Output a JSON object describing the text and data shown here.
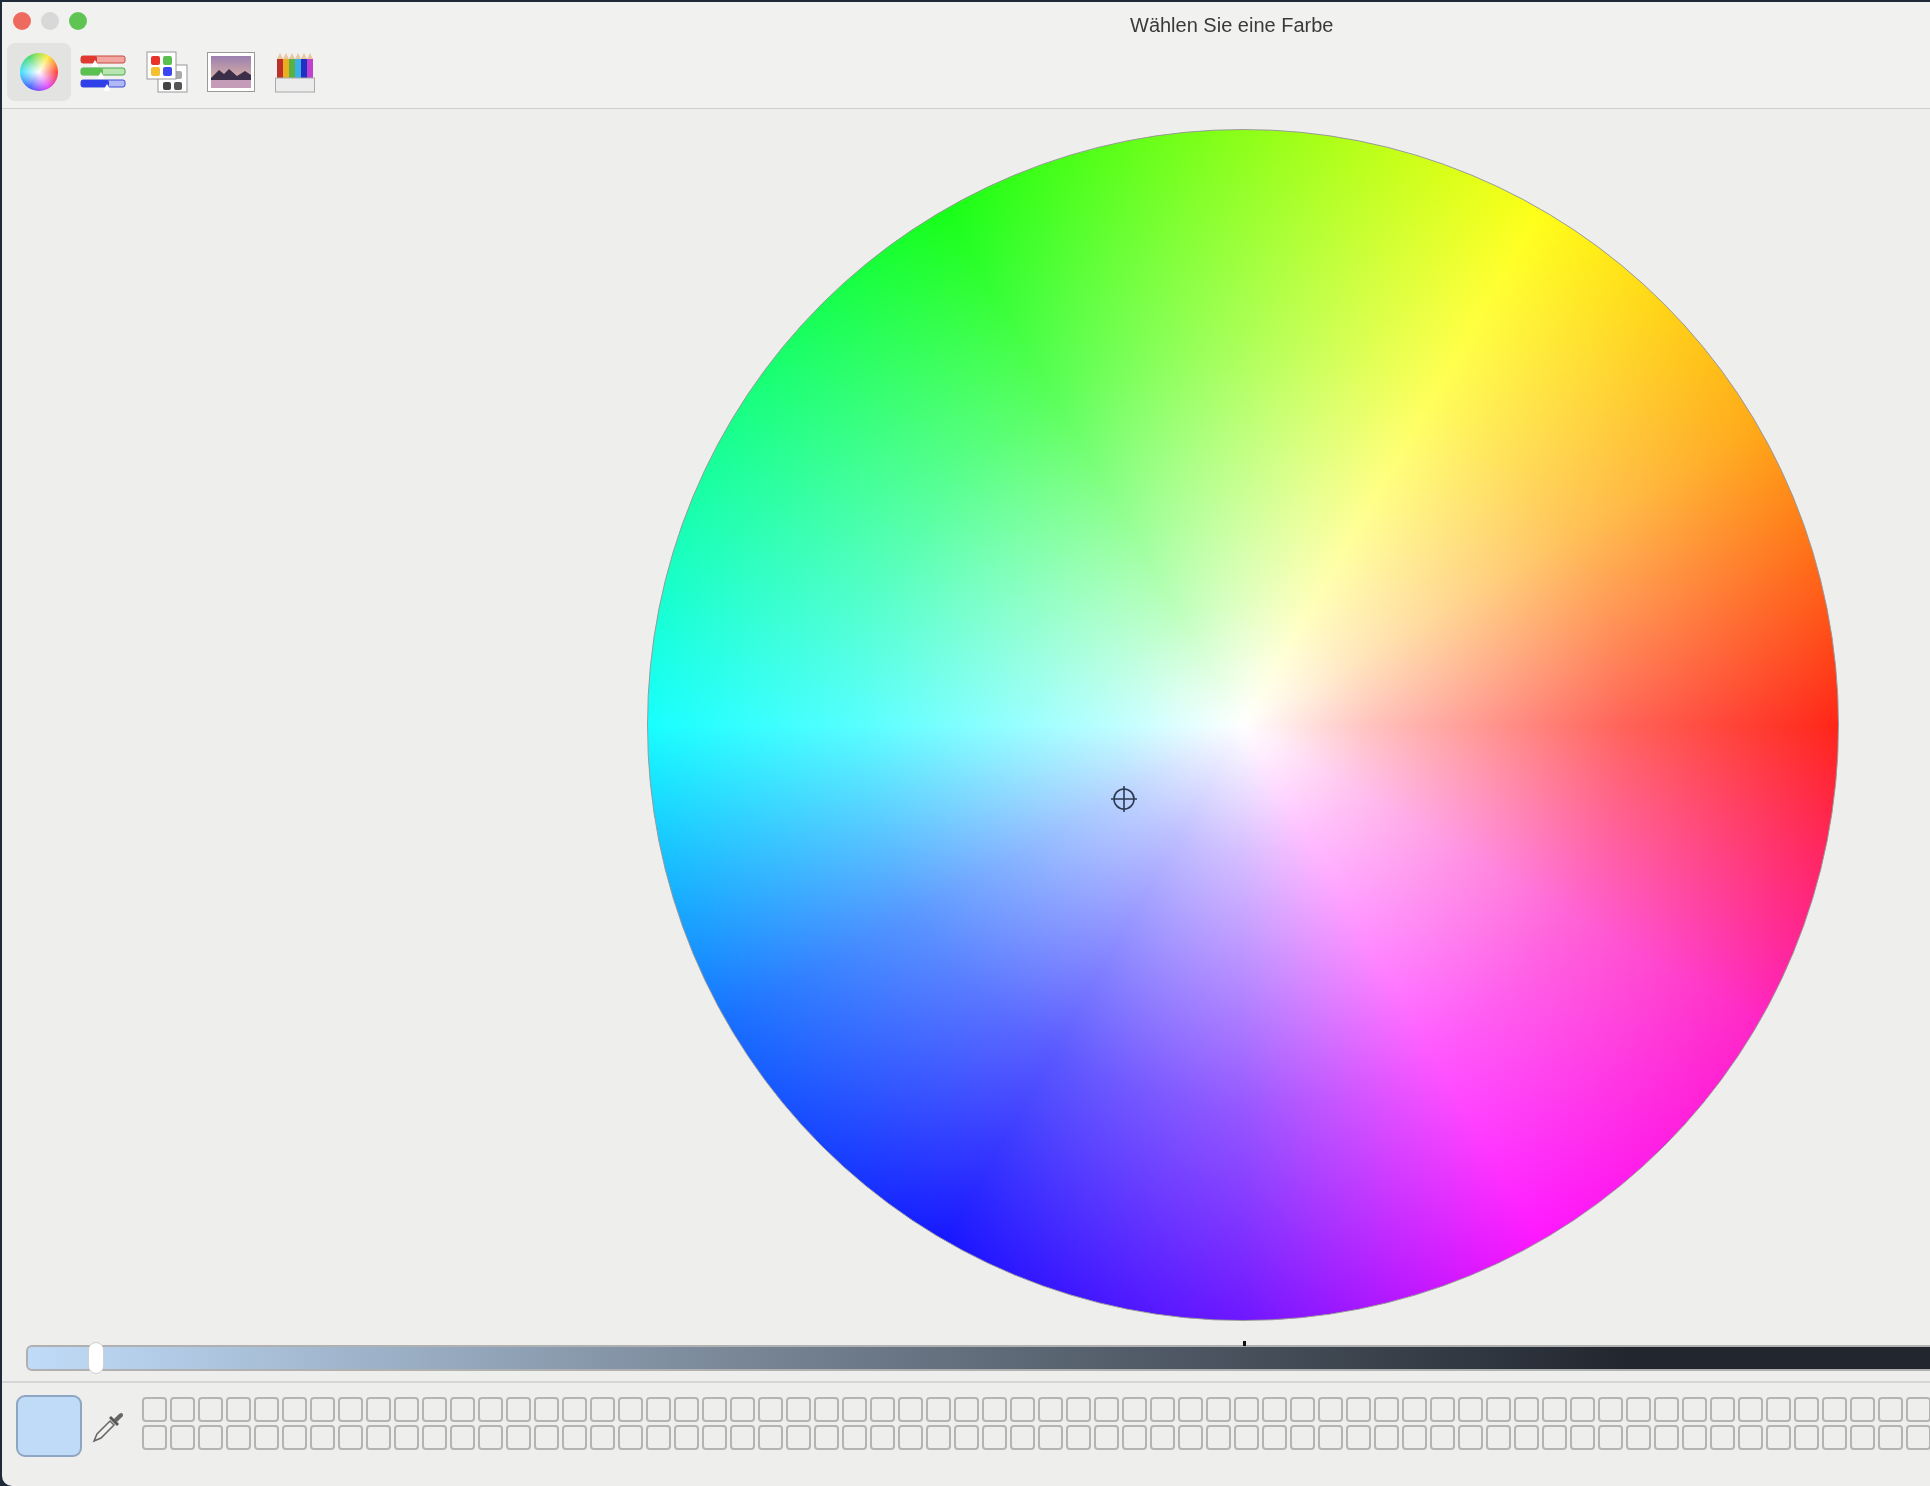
{
  "window": {
    "title": "Wählen Sie eine Farbe"
  },
  "tabs": [
    {
      "kind": "wheel",
      "selected": true
    },
    {
      "kind": "sliders",
      "selected": false
    },
    {
      "kind": "palettes",
      "selected": false
    },
    {
      "kind": "image",
      "selected": false
    },
    {
      "kind": "pencils",
      "selected": false
    }
  ],
  "brightness_slider": {
    "level": 0.03
  },
  "current_color": {
    "color": "#c0dbf8"
  }
}
